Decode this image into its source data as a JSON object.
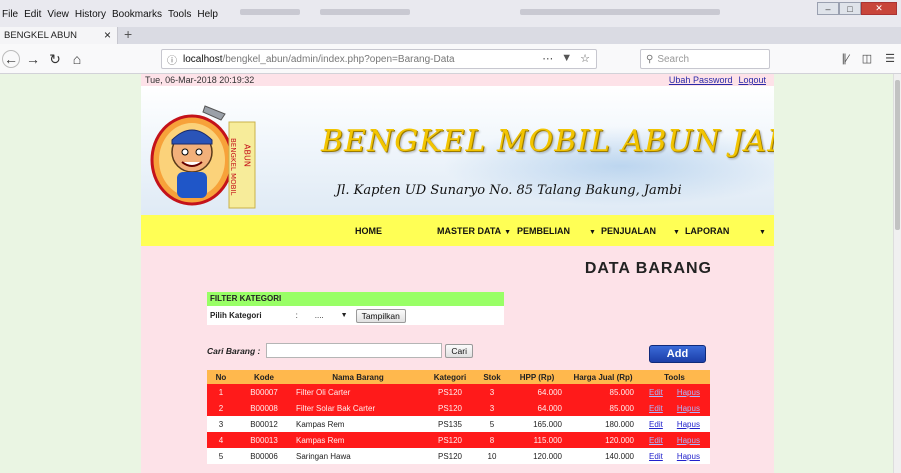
{
  "browser": {
    "menu": [
      "File",
      "Edit",
      "View",
      "History",
      "Bookmarks",
      "Tools",
      "Help"
    ],
    "tab_title": "BENGKEL ABUN",
    "url_host": "localhost",
    "url_path": "/bengkel_abun/admin/index.php?open=Barang-Data",
    "search_placeholder": "Search"
  },
  "topline": {
    "date": "Tue, 06-Mar-2018 20:19:32",
    "change_password": "Ubah Password",
    "logout": "Logout"
  },
  "banner": {
    "title": "BENGKEL MOBIL ABUN JAMBI",
    "subtitle": "Jl. Kapten UD Sunaryo No. 85 Talang Bakung, Jambi",
    "logo_text_left": "BENGKEL MOBIL",
    "logo_text_right": "ABUN"
  },
  "nav": {
    "home": "HOME",
    "master": "MASTER DATA",
    "pembelian": "PEMBELIAN",
    "penjualan": "PENJUALAN",
    "laporan": "LAPORAN"
  },
  "page_title": "DATA BARANG",
  "filter": {
    "header": "FILTER KATEGORI",
    "label": "Pilih Kategori",
    "colon": ":",
    "selected": "....",
    "button": "Tampilkan"
  },
  "search": {
    "label": "Cari Barang :",
    "value": "",
    "button": "Cari"
  },
  "add_button": "Add",
  "table": {
    "columns": [
      "No",
      "Kode",
      "Nama Barang",
      "Kategori",
      "Stok",
      "HPP (Rp)",
      "Harga Jual (Rp)",
      "Tools"
    ],
    "rows": [
      {
        "no": "1",
        "kode": "B00007",
        "nama": "Filter Oli Carter",
        "kategori": "PS120",
        "stok": "3",
        "hpp": "64.000",
        "jual": "85.000",
        "edit": "Edit",
        "hapus": "Hapus",
        "low": true
      },
      {
        "no": "2",
        "kode": "B00008",
        "nama": "Filter Solar Bak Carter",
        "kategori": "PS120",
        "stok": "3",
        "hpp": "64.000",
        "jual": "85.000",
        "edit": "Edit",
        "hapus": "Hapus",
        "low": true
      },
      {
        "no": "3",
        "kode": "B00012",
        "nama": "Kampas Rem",
        "kategori": "PS135",
        "stok": "5",
        "hpp": "165.000",
        "jual": "180.000",
        "edit": "Edit",
        "hapus": "Hapus",
        "low": false
      },
      {
        "no": "4",
        "kode": "B00013",
        "nama": "Kampas Rem",
        "kategori": "PS120",
        "stok": "8",
        "hpp": "115.000",
        "jual": "120.000",
        "edit": "Edit",
        "hapus": "Hapus",
        "low": true
      },
      {
        "no": "5",
        "kode": "B00006",
        "nama": "Saringan Hawa",
        "kategori": "PS120",
        "stok": "10",
        "hpp": "120.000",
        "jual": "140.000",
        "edit": "Edit",
        "hapus": "Hapus",
        "low": false
      }
    ]
  },
  "colors": {
    "page_bg": "#eaf5e3",
    "content_bg": "#fde2e8",
    "nav_bg": "#ffff55",
    "filter_header": "#99ff66",
    "table_header": "#ffb84d",
    "low_stock_row": "#ff1a1a",
    "title_gold": "#f2c400"
  }
}
